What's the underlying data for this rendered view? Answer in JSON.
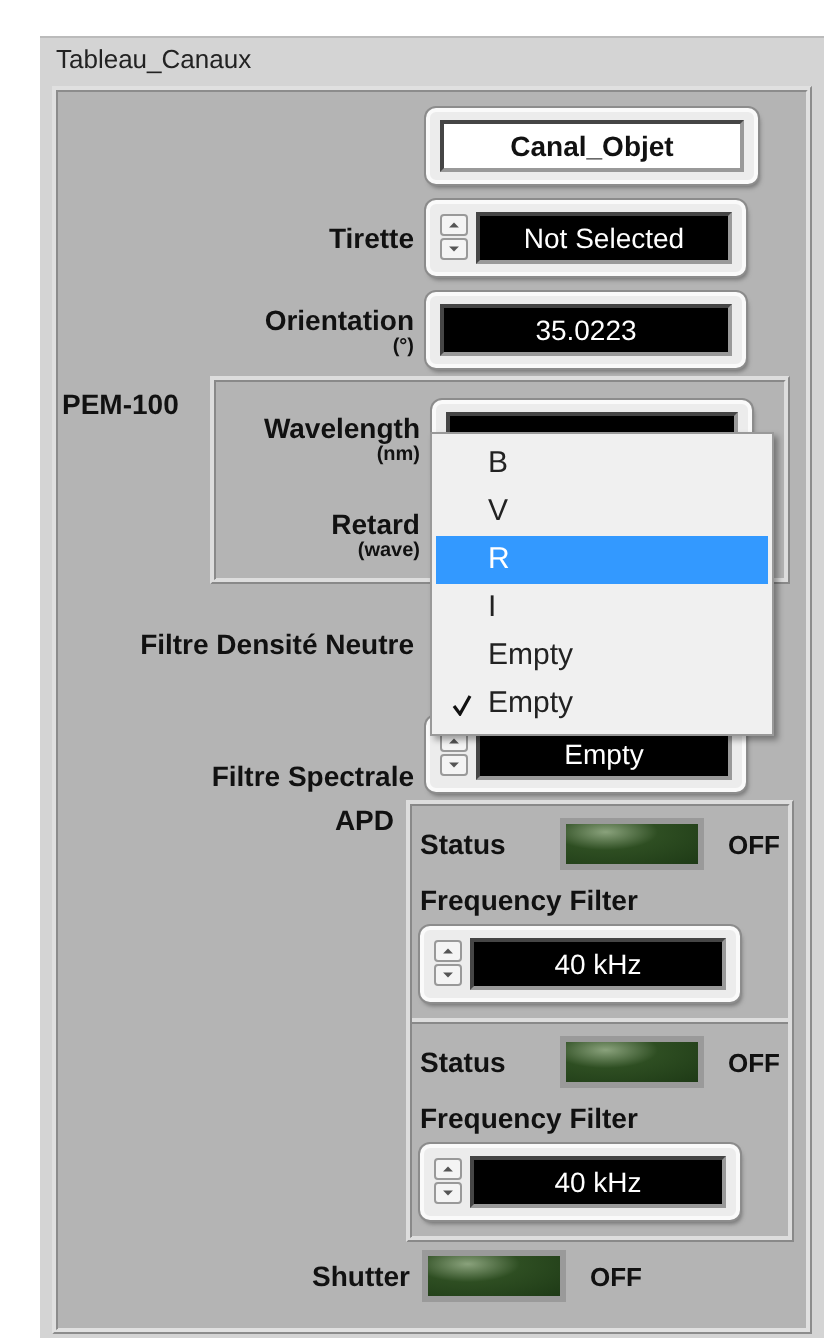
{
  "panel": {
    "title": "Tableau_Canaux"
  },
  "channel_button": {
    "label": "Canal_Objet"
  },
  "tirette": {
    "label": "Tirette",
    "value": "Not Selected"
  },
  "orientation": {
    "label": "Orientation",
    "unit": "(°)",
    "value": "35.0223"
  },
  "pem": {
    "label": "PEM-100",
    "fields": [
      {
        "label": "Wavelength",
        "unit": "(nm)"
      },
      {
        "label": "Retard",
        "unit": "(wave)"
      }
    ]
  },
  "neutral_filter": {
    "label": "Filtre Densité Neutre"
  },
  "spectral_filter": {
    "label": "Filtre Spectrale",
    "value": "Empty"
  },
  "dropdown": {
    "items": [
      {
        "label": "B",
        "selected": false,
        "checked": false
      },
      {
        "label": "V",
        "selected": false,
        "checked": false
      },
      {
        "label": "R",
        "selected": true,
        "checked": false
      },
      {
        "label": "I",
        "selected": false,
        "checked": false
      },
      {
        "label": "Empty",
        "selected": false,
        "checked": false
      },
      {
        "label": "Empty",
        "selected": false,
        "checked": true
      }
    ]
  },
  "apd": {
    "label": "APD",
    "channels": [
      {
        "status_label": "Status",
        "on": false,
        "state": "OFF",
        "filter_label": "Frequency Filter",
        "filter_value": "40 kHz"
      },
      {
        "status_label": "Status",
        "on": false,
        "state": "OFF",
        "filter_label": "Frequency Filter",
        "filter_value": "40 kHz"
      }
    ]
  },
  "shutter": {
    "label": "Shutter",
    "on": false,
    "state": "OFF"
  }
}
